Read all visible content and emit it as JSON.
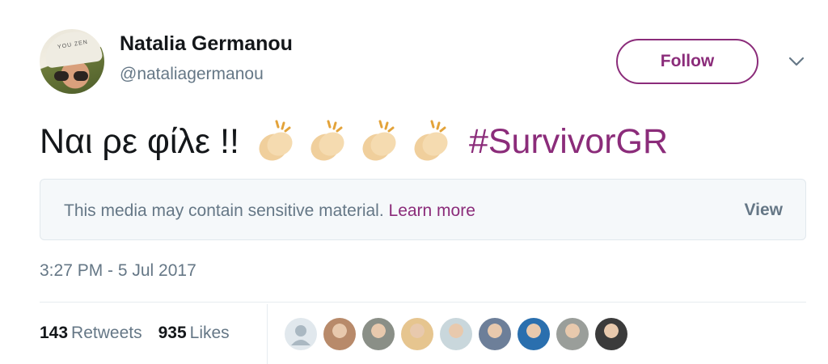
{
  "user": {
    "name": "Natalia Germanou",
    "handle": "@nataliagermanou",
    "avatar_text": "YOU ZEN"
  },
  "follow": {
    "label": "Follow"
  },
  "tweet": {
    "text": "Ναι ρε φίλε !!",
    "emoji": [
      "clapping-hands",
      "clapping-hands",
      "clapping-hands",
      "clapping-hands"
    ],
    "hashtag": "#SurvivorGR"
  },
  "media_notice": {
    "message": "This media may contain sensitive material.",
    "learn_more": "Learn more",
    "view_label": "View"
  },
  "timestamp": "3:27 PM - 5 Jul 2017",
  "stats": {
    "retweets_count": "143",
    "retweets_label": "Retweets",
    "likes_count": "935",
    "likes_label": "Likes"
  },
  "likers": [
    {
      "icon": "default-avatar",
      "color": "#aab8c2"
    },
    {
      "icon": "user-avatar",
      "color": "#b88a6a"
    },
    {
      "icon": "user-avatar",
      "color": "#8a8f87"
    },
    {
      "icon": "user-avatar",
      "color": "#e6c58f"
    },
    {
      "icon": "user-avatar",
      "color": "#c9d7dc"
    },
    {
      "icon": "user-avatar",
      "color": "#6d7f99"
    },
    {
      "icon": "user-avatar",
      "color": "#2a6fae"
    },
    {
      "icon": "user-avatar",
      "color": "#9a9e9a"
    },
    {
      "icon": "user-avatar",
      "color": "#3b3b3b"
    }
  ],
  "colors": {
    "accent": "#8b2c7a",
    "secondary_text": "#657786",
    "primary_text": "#14171a"
  }
}
